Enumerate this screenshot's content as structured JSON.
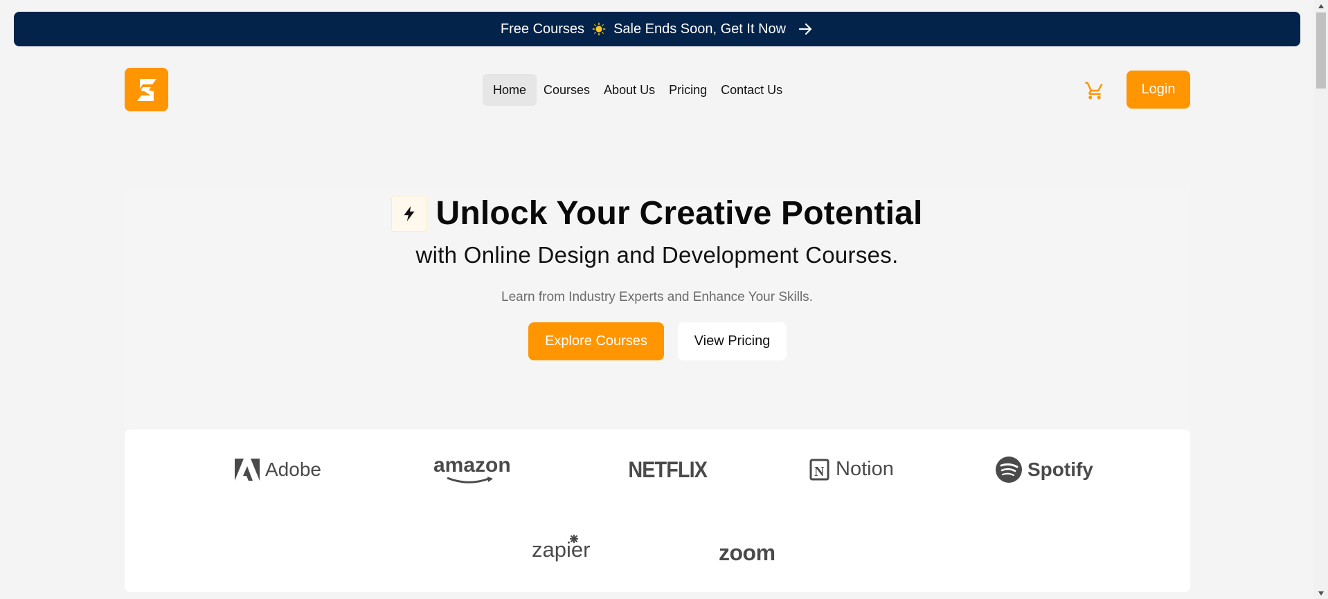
{
  "banner": {
    "text_left": "Free Courses",
    "text_right": "Sale Ends Soon, Get It Now",
    "icons": [
      "sun-icon",
      "arrow-right-icon"
    ]
  },
  "header": {
    "logo_icon": "brand-s-logo",
    "nav": [
      {
        "label": "Home",
        "active": true
      },
      {
        "label": "Courses"
      },
      {
        "label": "About Us"
      },
      {
        "label": "Pricing"
      },
      {
        "label": "Contact Us"
      }
    ],
    "cart_icon": "cart-icon",
    "login_label": "Login"
  },
  "hero": {
    "badge_icon": "lightning-icon",
    "title": "Unlock Your Creative Potential",
    "subtitle": "with Online Design and Development Courses.",
    "description": "Learn from Industry Experts and Enhance Your Skills.",
    "explore_label": "Explore Courses",
    "pricing_label": "View Pricing"
  },
  "brands": [
    {
      "name": "Adobe"
    },
    {
      "name": "amazon"
    },
    {
      "name": "NETFLIX"
    },
    {
      "name": "Notion"
    },
    {
      "name": "Spotify"
    },
    {
      "name": "zapier"
    },
    {
      "name": "zoom"
    }
  ],
  "colors": {
    "accent": "#ff9500",
    "banner_bg": "#03234a",
    "page_bg": "#f4f4f4",
    "brand_gray": "#4a4a4a"
  }
}
